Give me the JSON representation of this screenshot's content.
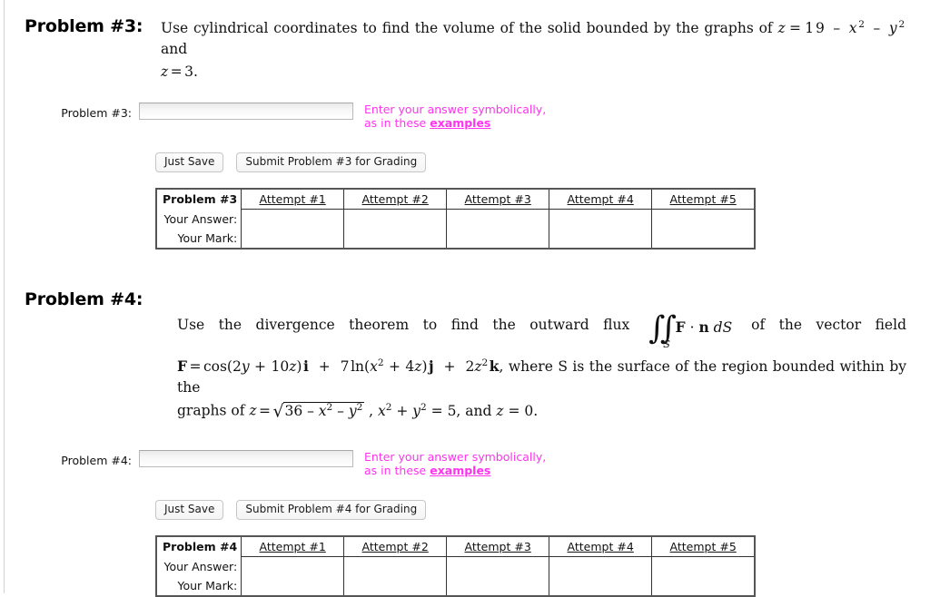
{
  "colors": {
    "hint": "#ff33ee",
    "table_border": "#555555",
    "page_rule": "#d4d4d4"
  },
  "problems": [
    {
      "title": "Problem #3:",
      "statement_line1_pre": "Use cylindrical coordinates to find the volume of the solid bounded by the graphs of ",
      "statement_eq1": "z = 19 − x² − y²",
      "statement_line1_post": " and",
      "statement_line2": "z = 3.",
      "answer_label": "Problem #3:",
      "answer_value": "",
      "answer_placeholder": "",
      "hint_line1": "Enter your answer symbolically,",
      "hint_line2_pre": "as in these ",
      "hint_link": "examples",
      "just_save_label": "Just Save",
      "submit_label": "Submit Problem #3 for Grading",
      "table": {
        "corner_label": "Problem #3",
        "row_labels": [
          "Your Answer:",
          "Your Mark:"
        ],
        "attempt_headers": [
          "Attempt #1",
          "Attempt #2",
          "Attempt #3",
          "Attempt #4",
          "Attempt #5"
        ],
        "answer_cells": [
          "",
          "",
          "",
          "",
          ""
        ],
        "mark_cells": [
          "",
          "",
          "",
          "",
          ""
        ]
      }
    },
    {
      "title": "Problem #4:",
      "statement_line1_pre": "Use the divergence theorem to find the outward flux ",
      "integral_symbol": "∬",
      "integral_subscript": "S",
      "integrand": "F · n dS",
      "statement_line1_post": " of the vector field",
      "field_lhs": "F =",
      "field_terms": "cos(2y + 10z) i + 7 ln(x² + 4z) j + 2z² k,",
      "field_tail": "where S is the surface of the region bounded within by the",
      "graphs_pre": "graphs of z = ",
      "graphs_radicand": "36 − x² − y²",
      "graphs_post": ", x² + y² = 5, and z = 0.",
      "answer_label": "Problem #4:",
      "answer_value": "",
      "answer_placeholder": "",
      "hint_line1": "Enter your answer symbolically,",
      "hint_line2_pre": "as in these ",
      "hint_link": "examples",
      "just_save_label": "Just Save",
      "submit_label": "Submit Problem #4 for Grading",
      "table": {
        "corner_label": "Problem #4",
        "row_labels": [
          "Your Answer:",
          "Your Mark:"
        ],
        "attempt_headers": [
          "Attempt #1",
          "Attempt #2",
          "Attempt #3",
          "Attempt #4",
          "Attempt #5"
        ],
        "answer_cells": [
          "",
          "",
          "",
          "",
          ""
        ],
        "mark_cells": [
          "",
          "",
          "",
          "",
          ""
        ]
      }
    }
  ]
}
